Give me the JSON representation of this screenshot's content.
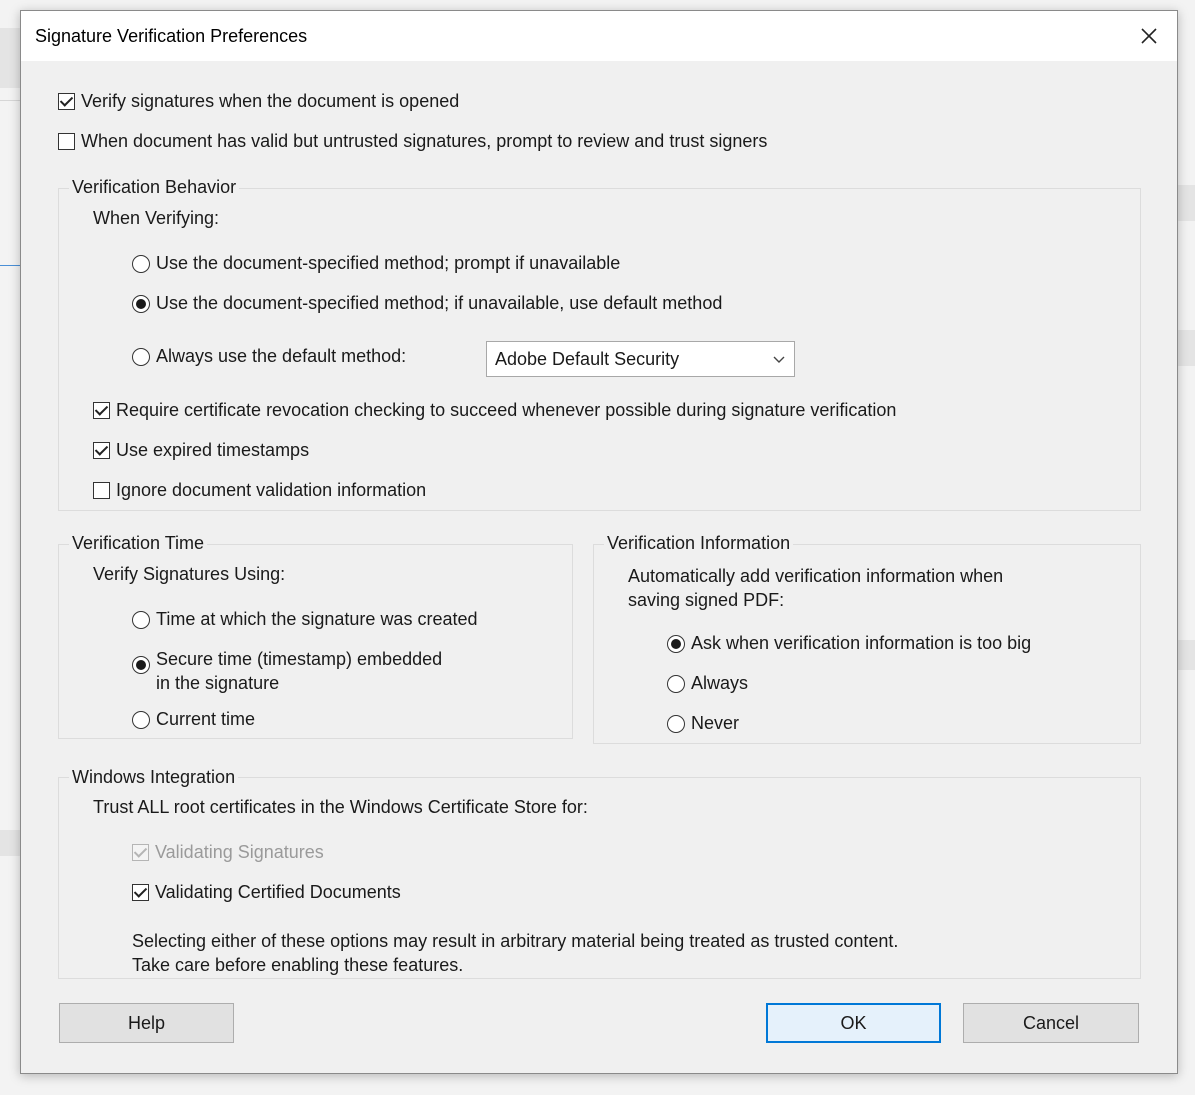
{
  "dialog": {
    "title": "Signature Verification Preferences"
  },
  "general": {
    "verify_on_open": {
      "label": "Verify signatures when the document is opened",
      "checked": true
    },
    "prompt_untrusted": {
      "label": "When document has valid but untrusted signatures, prompt to review and trust signers",
      "checked": false
    }
  },
  "verification_behavior": {
    "legend": "Verification Behavior",
    "subheading": "When Verifying:",
    "options": [
      {
        "label": "Use the document-specified method; prompt if unavailable",
        "selected": false
      },
      {
        "label": "Use the document-specified method; if unavailable, use default method",
        "selected": true
      },
      {
        "label": "Always use the default method:",
        "selected": false
      }
    ],
    "default_method": "Adobe Default Security",
    "require_revocation": {
      "label": "Require certificate revocation checking to succeed whenever possible during signature verification",
      "checked": true
    },
    "use_expired": {
      "label": "Use expired timestamps",
      "checked": true
    },
    "ignore_validation": {
      "label": "Ignore document validation information",
      "checked": false
    }
  },
  "verification_time": {
    "legend": "Verification Time",
    "subheading": "Verify Signatures Using:",
    "options": [
      {
        "label": "Time at which the signature was created",
        "selected": false
      },
      {
        "label_line1": "Secure time (timestamp) embedded",
        "label_line2": "in the signature",
        "selected": true
      },
      {
        "label": "Current time",
        "selected": false
      }
    ]
  },
  "verification_info": {
    "legend": "Verification Information",
    "description_line1": "Automatically add verification information when",
    "description_line2": "saving signed PDF:",
    "options": [
      {
        "label": "Ask when verification information is too big",
        "selected": true
      },
      {
        "label": "Always",
        "selected": false
      },
      {
        "label": "Never",
        "selected": false
      }
    ]
  },
  "windows_integration": {
    "legend": "Windows Integration",
    "subheading": "Trust ALL root certificates in the Windows Certificate Store for:",
    "validating_signatures": {
      "label": "Validating Signatures",
      "checked": true,
      "disabled": true
    },
    "validating_certified": {
      "label": "Validating Certified Documents",
      "checked": true
    },
    "warning_line1": "Selecting either of these options may result in arbitrary material being treated as trusted content.",
    "warning_line2": "Take care before enabling these features."
  },
  "buttons": {
    "help": "Help",
    "ok": "OK",
    "cancel": "Cancel"
  }
}
